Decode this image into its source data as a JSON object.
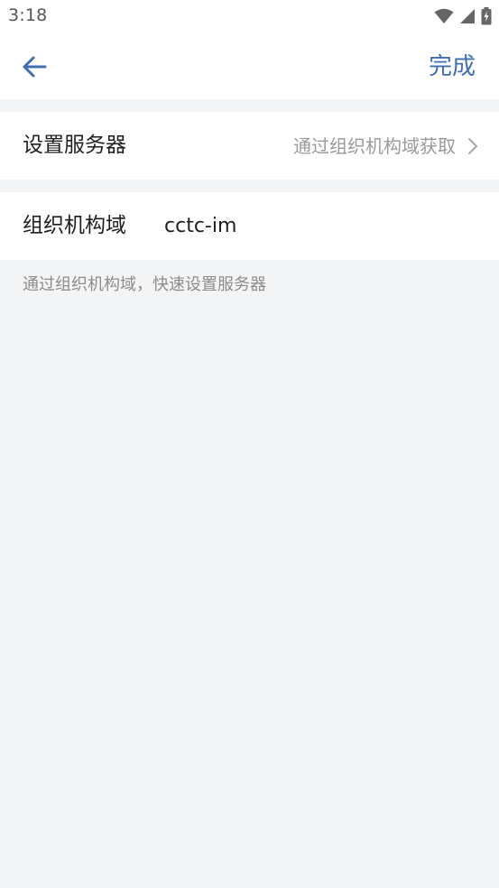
{
  "status_bar": {
    "time": "3:18"
  },
  "header": {
    "back_icon": "arrow-left-icon",
    "done_label": "完成"
  },
  "server_row": {
    "label": "设置服务器",
    "value": "通过组织机构域获取",
    "chevron_icon": "chevron-right-icon"
  },
  "domain_row": {
    "label": "组织机构域",
    "value": "cctc-im"
  },
  "hint": "通过组织机构域，快速设置服务器",
  "colors": {
    "accent": "#3f6fb1",
    "background": "#f3f4f6",
    "secondary_text": "#9a9a9a"
  }
}
